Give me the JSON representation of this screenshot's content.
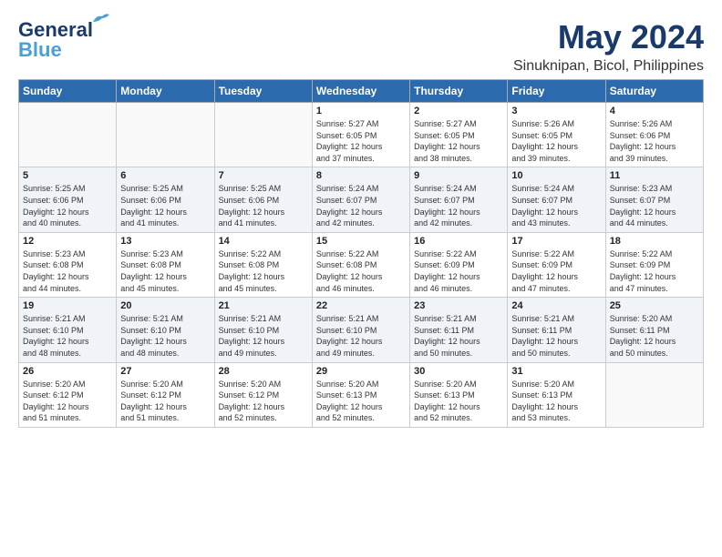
{
  "header": {
    "logo_line1": "General",
    "logo_line2": "Blue",
    "month": "May 2024",
    "location": "Sinuknipan, Bicol, Philippines"
  },
  "weekdays": [
    "Sunday",
    "Monday",
    "Tuesday",
    "Wednesday",
    "Thursday",
    "Friday",
    "Saturday"
  ],
  "weeks": [
    [
      {
        "day": "",
        "info": ""
      },
      {
        "day": "",
        "info": ""
      },
      {
        "day": "",
        "info": ""
      },
      {
        "day": "1",
        "info": "Sunrise: 5:27 AM\nSunset: 6:05 PM\nDaylight: 12 hours\nand 37 minutes."
      },
      {
        "day": "2",
        "info": "Sunrise: 5:27 AM\nSunset: 6:05 PM\nDaylight: 12 hours\nand 38 minutes."
      },
      {
        "day": "3",
        "info": "Sunrise: 5:26 AM\nSunset: 6:05 PM\nDaylight: 12 hours\nand 39 minutes."
      },
      {
        "day": "4",
        "info": "Sunrise: 5:26 AM\nSunset: 6:06 PM\nDaylight: 12 hours\nand 39 minutes."
      }
    ],
    [
      {
        "day": "5",
        "info": "Sunrise: 5:25 AM\nSunset: 6:06 PM\nDaylight: 12 hours\nand 40 minutes."
      },
      {
        "day": "6",
        "info": "Sunrise: 5:25 AM\nSunset: 6:06 PM\nDaylight: 12 hours\nand 41 minutes."
      },
      {
        "day": "7",
        "info": "Sunrise: 5:25 AM\nSunset: 6:06 PM\nDaylight: 12 hours\nand 41 minutes."
      },
      {
        "day": "8",
        "info": "Sunrise: 5:24 AM\nSunset: 6:07 PM\nDaylight: 12 hours\nand 42 minutes."
      },
      {
        "day": "9",
        "info": "Sunrise: 5:24 AM\nSunset: 6:07 PM\nDaylight: 12 hours\nand 42 minutes."
      },
      {
        "day": "10",
        "info": "Sunrise: 5:24 AM\nSunset: 6:07 PM\nDaylight: 12 hours\nand 43 minutes."
      },
      {
        "day": "11",
        "info": "Sunrise: 5:23 AM\nSunset: 6:07 PM\nDaylight: 12 hours\nand 44 minutes."
      }
    ],
    [
      {
        "day": "12",
        "info": "Sunrise: 5:23 AM\nSunset: 6:08 PM\nDaylight: 12 hours\nand 44 minutes."
      },
      {
        "day": "13",
        "info": "Sunrise: 5:23 AM\nSunset: 6:08 PM\nDaylight: 12 hours\nand 45 minutes."
      },
      {
        "day": "14",
        "info": "Sunrise: 5:22 AM\nSunset: 6:08 PM\nDaylight: 12 hours\nand 45 minutes."
      },
      {
        "day": "15",
        "info": "Sunrise: 5:22 AM\nSunset: 6:08 PM\nDaylight: 12 hours\nand 46 minutes."
      },
      {
        "day": "16",
        "info": "Sunrise: 5:22 AM\nSunset: 6:09 PM\nDaylight: 12 hours\nand 46 minutes."
      },
      {
        "day": "17",
        "info": "Sunrise: 5:22 AM\nSunset: 6:09 PM\nDaylight: 12 hours\nand 47 minutes."
      },
      {
        "day": "18",
        "info": "Sunrise: 5:22 AM\nSunset: 6:09 PM\nDaylight: 12 hours\nand 47 minutes."
      }
    ],
    [
      {
        "day": "19",
        "info": "Sunrise: 5:21 AM\nSunset: 6:10 PM\nDaylight: 12 hours\nand 48 minutes."
      },
      {
        "day": "20",
        "info": "Sunrise: 5:21 AM\nSunset: 6:10 PM\nDaylight: 12 hours\nand 48 minutes."
      },
      {
        "day": "21",
        "info": "Sunrise: 5:21 AM\nSunset: 6:10 PM\nDaylight: 12 hours\nand 49 minutes."
      },
      {
        "day": "22",
        "info": "Sunrise: 5:21 AM\nSunset: 6:10 PM\nDaylight: 12 hours\nand 49 minutes."
      },
      {
        "day": "23",
        "info": "Sunrise: 5:21 AM\nSunset: 6:11 PM\nDaylight: 12 hours\nand 50 minutes."
      },
      {
        "day": "24",
        "info": "Sunrise: 5:21 AM\nSunset: 6:11 PM\nDaylight: 12 hours\nand 50 minutes."
      },
      {
        "day": "25",
        "info": "Sunrise: 5:20 AM\nSunset: 6:11 PM\nDaylight: 12 hours\nand 50 minutes."
      }
    ],
    [
      {
        "day": "26",
        "info": "Sunrise: 5:20 AM\nSunset: 6:12 PM\nDaylight: 12 hours\nand 51 minutes."
      },
      {
        "day": "27",
        "info": "Sunrise: 5:20 AM\nSunset: 6:12 PM\nDaylight: 12 hours\nand 51 minutes."
      },
      {
        "day": "28",
        "info": "Sunrise: 5:20 AM\nSunset: 6:12 PM\nDaylight: 12 hours\nand 52 minutes."
      },
      {
        "day": "29",
        "info": "Sunrise: 5:20 AM\nSunset: 6:13 PM\nDaylight: 12 hours\nand 52 minutes."
      },
      {
        "day": "30",
        "info": "Sunrise: 5:20 AM\nSunset: 6:13 PM\nDaylight: 12 hours\nand 52 minutes."
      },
      {
        "day": "31",
        "info": "Sunrise: 5:20 AM\nSunset: 6:13 PM\nDaylight: 12 hours\nand 53 minutes."
      },
      {
        "day": "",
        "info": ""
      }
    ]
  ]
}
